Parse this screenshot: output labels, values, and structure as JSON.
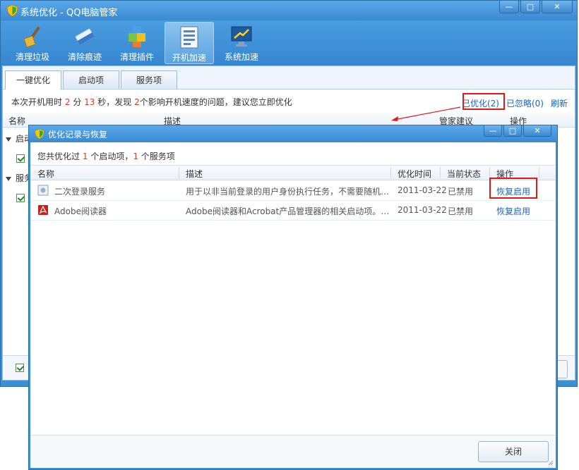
{
  "window": {
    "title": "系统优化 - QQ电脑管家",
    "min": "—",
    "max": "□",
    "close": "✕"
  },
  "toolbar": [
    {
      "label": "清理垃圾",
      "icon": "broom-icon"
    },
    {
      "label": "清除痕迹",
      "icon": "eraser-icon"
    },
    {
      "label": "清理插件",
      "icon": "puzzle-icon"
    },
    {
      "label": "开机加速",
      "icon": "startup-list-icon"
    },
    {
      "label": "系统加速",
      "icon": "monitor-speed-icon"
    }
  ],
  "tabs": [
    "一键优化",
    "启动项",
    "服务项"
  ],
  "summary": {
    "prefix": "本次开机用时",
    "minutes": "2",
    "min_unit": "分",
    "seconds": "13",
    "sec_unit": "秒，发现",
    "issues": "2",
    "suffix": "个影响开机速度的问题，建议您立即优化"
  },
  "links": {
    "optimized": "已优化(2)",
    "ignored": "已忽略(0)",
    "refresh": "刷新"
  },
  "main_columns": [
    "名称",
    "描述",
    "管家建议",
    "操作"
  ],
  "groups": [
    "启动",
    "服务"
  ],
  "dialog": {
    "title": "优化记录与恢复",
    "summary": {
      "prefix": "您共优化过",
      "startup_count": "1",
      "middle": "个启动项，",
      "service_count": "1",
      "suffix": "个服务项"
    },
    "columns": [
      "名称",
      "描述",
      "优化时间",
      "当前状态",
      "操作"
    ],
    "rows": [
      {
        "name": "二次登录服务",
        "desc": "用于以非当前登录的用户身份执行任务，不需要随机…",
        "time": "2011-03-22",
        "status": "已禁用",
        "action": "恢复启用",
        "icon": "service-icon"
      },
      {
        "name": "Adobe阅读器",
        "desc": "Adobe阅读器和Acrobat产品管理器的相关启动项。用…",
        "time": "2011-03-22",
        "status": "已禁用",
        "action": "恢复启用",
        "icon": "adobe-reader-icon"
      }
    ],
    "close_button": "关闭",
    "min": "—",
    "max": "□",
    "close": "✕"
  },
  "colors": {
    "accent": "#3b8fd6",
    "highlight": "#e01818",
    "link": "#1a64c2",
    "count": "#e03a1e"
  }
}
